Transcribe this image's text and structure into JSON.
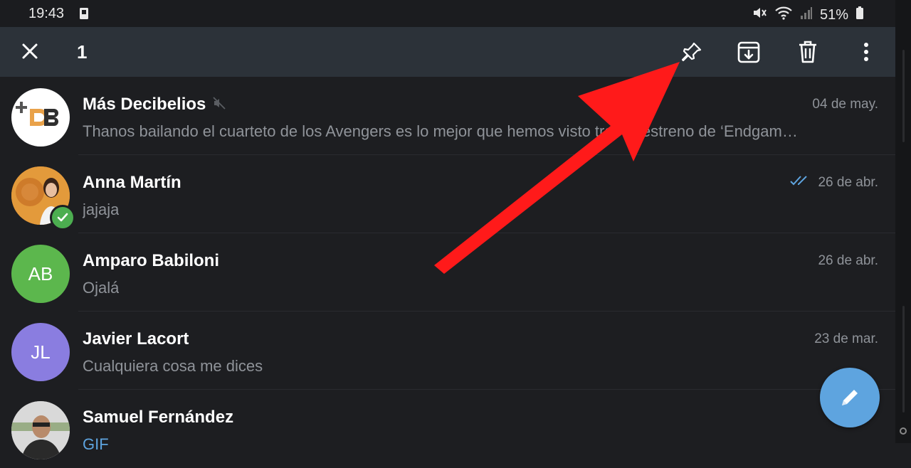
{
  "status_bar": {
    "time": "19:43",
    "battery": "51%",
    "icons": [
      "sim-icon",
      "mute-icon",
      "wifi-icon",
      "signal-icon",
      "battery-icon"
    ]
  },
  "action_bar": {
    "selected_count": "1",
    "actions": [
      "close-icon",
      "pin-icon",
      "archive-icon",
      "delete-icon",
      "more-icon"
    ],
    "background": "#2c3239"
  },
  "chats": [
    {
      "name": "Más Decibelios",
      "message": "Thanos bailando el cuarteto de los Avengers es lo mejor que hemos visto tras el estreno de ‘Endgam…",
      "date": "04 de may.",
      "muted": true,
      "avatar_text": "+DB",
      "avatar_color": "#ffffff"
    },
    {
      "name": "Anna Martín",
      "message": "jajaja",
      "date": "26 de abr.",
      "read": true,
      "selected": true,
      "avatar_color": "#e08a2c"
    },
    {
      "name": "Amparo Babiloni",
      "message": "Ojalá",
      "date": "26 de abr.",
      "avatar_text": "AB",
      "avatar_color": "#5cb74d"
    },
    {
      "name": "Javier Lacort",
      "message": "Cualquiera cosa me dices",
      "date": "23 de mar.",
      "avatar_text": "JL",
      "avatar_color": "#8a7de0"
    },
    {
      "name": "Samuel Fernández",
      "message": "GIF",
      "avatar_color": "#c9c9c9"
    }
  ],
  "colors": {
    "background": "#1d1e21",
    "accent": "#5ea4df",
    "annotation": "#ff1a1a",
    "muted_text": "#8f9399"
  }
}
